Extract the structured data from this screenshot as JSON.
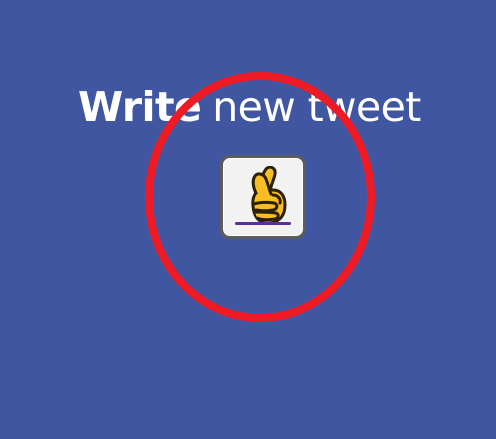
{
  "composer": {
    "heading_strong": "Write",
    "heading_rest": "new tweet"
  },
  "emoji_button": {
    "icon": "crossed-fingers-emoji-icon"
  },
  "colors": {
    "background": "#4056a1",
    "heading_text": "#ffffff",
    "button_background": "#f2f2f2",
    "button_border": "#5c5c5c",
    "emoji_yellow": "#f6bd26",
    "emoji_outline": "#2b2107",
    "underline": "#5b2f9a",
    "highlight_ring": "#ef1b24"
  }
}
